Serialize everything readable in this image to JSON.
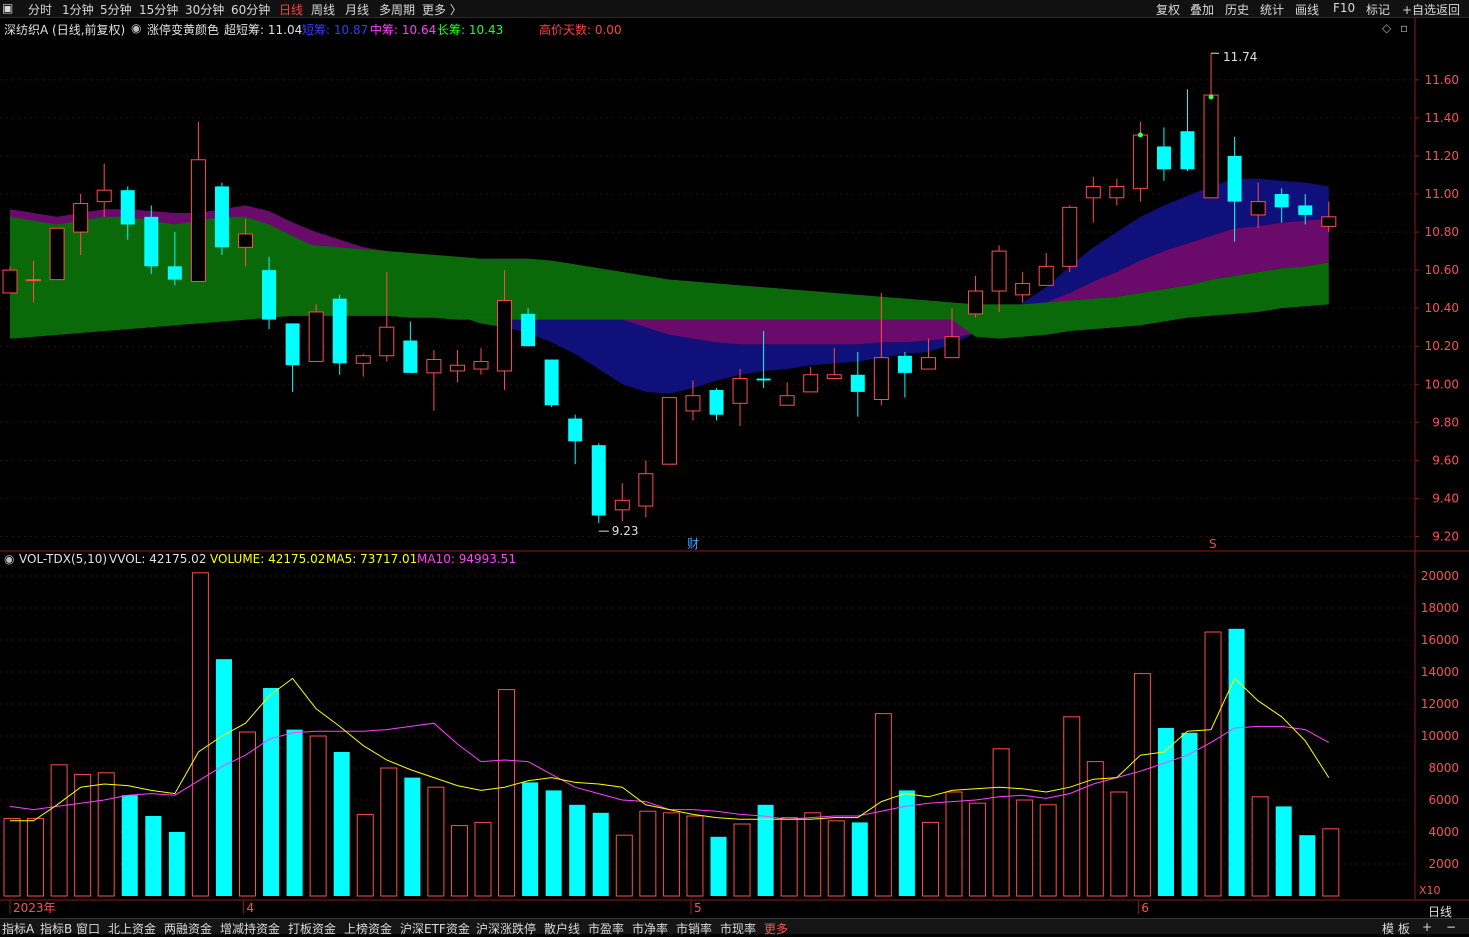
{
  "topbar": {
    "periods": [
      "分时",
      "1分钟",
      "5分钟",
      "15分钟",
      "30分钟",
      "60分钟",
      "日线",
      "周线",
      "月线",
      "多周期",
      "更多 〉"
    ],
    "active": "日线",
    "right": [
      "复权",
      "叠加",
      "历史",
      "统计",
      "画线",
      "F10",
      "标记",
      "+自选",
      "返回"
    ]
  },
  "main": {
    "stock": "深纺织A (日线,前复权)",
    "indicator": "涨停变黄颜色",
    "super_short": "超短筹: 11.04",
    "short": "短筹: 10.87",
    "mid": "中筹: 10.64",
    "long": "长筹: 10.43",
    "high_days": "高价天数: 0.00",
    "hi_label": "11.74",
    "lo_label": "9.23",
    "cai_marker": "财",
    "s_marker": "S"
  },
  "vol": {
    "title": "VOL-TDX(5,10)",
    "vvol": "VVOL: 42175.02",
    "volume": "VOLUME: 42175.02",
    "ma5": "MA5: 73717.01",
    "ma10": "MA10: 94993.51",
    "unit": "X10"
  },
  "period_label": "日线",
  "bottombar": {
    "tabs": [
      "指标A",
      "指标B",
      "窗口",
      "北上资金",
      "两融资金",
      "增减持资金",
      "打板资金",
      "上榜资金",
      "沪深ETF资金",
      "沪深涨跌停",
      "散户线",
      "市盈率",
      "市净率",
      "市销率",
      "市现率",
      "更多"
    ],
    "right": [
      "模 板",
      "+",
      "−"
    ]
  },
  "colors": {
    "up": "#ff4d4d",
    "down": "#00ffff",
    "ma5": "#ffff00",
    "ma10": "#ff40ff",
    "band_green": "#0a6a0a",
    "band_purple": "#6a0a6a",
    "band_blue": "#10107a"
  },
  "chart_data": {
    "type": "candlestick",
    "price_axis": {
      "ticks": [
        9.2,
        9.4,
        9.6,
        9.8,
        10.0,
        10.2,
        10.4,
        10.6,
        10.8,
        11.0,
        11.2,
        11.4,
        11.6
      ],
      "range": [
        9.15,
        11.82
      ]
    },
    "volume_axis": {
      "ticks": [
        2000,
        4000,
        6000,
        8000,
        10000,
        12000,
        14000,
        16000,
        18000,
        20000
      ],
      "range": [
        0,
        21000
      ],
      "unit": "X10"
    },
    "x_labels": [
      {
        "index": 0,
        "text": "2023年"
      },
      {
        "index": 10,
        "text": "4"
      },
      {
        "index": 29,
        "text": "5"
      },
      {
        "index": 48,
        "text": "6"
      }
    ],
    "candles": [
      [
        10.48,
        10.6,
        10.62,
        10.48
      ],
      [
        10.55,
        10.55,
        10.65,
        10.43
      ],
      [
        10.55,
        10.82,
        10.82,
        10.55
      ],
      [
        10.8,
        10.95,
        11.0,
        10.68
      ],
      [
        10.96,
        11.02,
        11.16,
        10.88
      ],
      [
        11.02,
        10.84,
        11.04,
        10.76
      ],
      [
        10.88,
        10.62,
        10.94,
        10.58
      ],
      [
        10.62,
        10.55,
        10.8,
        10.52
      ],
      [
        10.54,
        11.18,
        11.38,
        10.54
      ],
      [
        11.04,
        10.72,
        11.06,
        10.68
      ],
      [
        10.72,
        10.79,
        10.87,
        10.62
      ],
      [
        10.6,
        10.34,
        10.67,
        10.29
      ],
      [
        10.32,
        10.1,
        10.32,
        9.96
      ],
      [
        10.12,
        10.38,
        10.42,
        10.14
      ],
      [
        10.45,
        10.11,
        10.47,
        10.05
      ],
      [
        10.11,
        10.15,
        10.16,
        10.04
      ],
      [
        10.15,
        10.3,
        10.59,
        10.12
      ],
      [
        10.23,
        10.06,
        10.33,
        10.06
      ],
      [
        10.06,
        10.13,
        10.18,
        9.86
      ],
      [
        10.07,
        10.1,
        10.18,
        10.01
      ],
      [
        10.08,
        10.12,
        10.19,
        10.05
      ],
      [
        10.07,
        10.44,
        10.6,
        9.97
      ],
      [
        10.37,
        10.2,
        10.4,
        10.2
      ],
      [
        10.13,
        9.89,
        10.13,
        9.88
      ],
      [
        9.82,
        9.7,
        9.84,
        9.58
      ],
      [
        9.68,
        9.31,
        9.69,
        9.27
      ],
      [
        9.34,
        9.39,
        9.48,
        9.28
      ],
      [
        9.36,
        9.53,
        9.6,
        9.3
      ],
      [
        9.58,
        9.93,
        9.93,
        9.58
      ],
      [
        9.86,
        9.94,
        10.02,
        9.81
      ],
      [
        9.97,
        9.84,
        9.98,
        9.81
      ],
      [
        9.9,
        10.03,
        10.08,
        9.78
      ],
      [
        10.03,
        10.02,
        10.28,
        9.98
      ],
      [
        9.89,
        9.94,
        10.01,
        9.89
      ],
      [
        9.96,
        10.05,
        10.09,
        9.96
      ],
      [
        10.03,
        10.05,
        10.19,
        10.03
      ],
      [
        10.05,
        9.96,
        10.17,
        9.83
      ],
      [
        9.92,
        10.14,
        10.48,
        9.89
      ],
      [
        10.15,
        10.06,
        10.17,
        9.93
      ],
      [
        10.08,
        10.14,
        10.24,
        10.08
      ],
      [
        10.14,
        10.25,
        10.4,
        10.14
      ],
      [
        10.37,
        10.49,
        10.57,
        10.35
      ],
      [
        10.49,
        10.7,
        10.73,
        10.38
      ],
      [
        10.47,
        10.53,
        10.59,
        10.43
      ],
      [
        10.52,
        10.62,
        10.69,
        10.54
      ],
      [
        10.62,
        10.93,
        10.94,
        10.59
      ],
      [
        10.98,
        11.04,
        11.09,
        10.85
      ],
      [
        10.98,
        11.04,
        11.08,
        10.94
      ],
      [
        11.03,
        11.31,
        11.38,
        10.96
      ],
      [
        11.25,
        11.13,
        11.35,
        11.07
      ],
      [
        11.33,
        11.13,
        11.55,
        11.12
      ],
      [
        10.98,
        11.52,
        11.74,
        10.98
      ],
      [
        11.2,
        10.96,
        11.3,
        10.75
      ],
      [
        10.89,
        10.96,
        11.06,
        10.82
      ],
      [
        11.0,
        10.93,
        11.03,
        10.85
      ],
      [
        10.94,
        10.89,
        11.0,
        10.84
      ],
      [
        10.83,
        10.88,
        10.96,
        10.8
      ]
    ],
    "volumes": [
      4850,
      4850,
      8200,
      7600,
      7700,
      6300,
      5000,
      4000,
      20200,
      14800,
      10250,
      13000,
      10400,
      10000,
      9000,
      5100,
      8000,
      7400,
      6800,
      4400,
      4600,
      12900,
      7100,
      6600,
      5700,
      5200,
      3800,
      5300,
      5200,
      5000,
      3700,
      4500,
      5700,
      4900,
      5200,
      4700,
      4600,
      11400,
      6600,
      4600,
      6500,
      5800,
      9200,
      6000,
      5700,
      11200,
      8400,
      6500,
      13900,
      10500,
      10200,
      16500,
      16700,
      6200,
      5600,
      3800,
      4200
    ],
    "ma5": [
      4700,
      4700,
      5700,
      6800,
      7000,
      6900,
      6600,
      6400,
      9000,
      10000,
      10800,
      12500,
      13600,
      11700,
      10600,
      9400,
      8500,
      7900,
      7400,
      6900,
      6600,
      6800,
      7200,
      7400,
      7100,
      7000,
      6800,
      5700,
      5400,
      5100,
      4900,
      4800,
      4800,
      4800,
      4800,
      4900,
      4900,
      5900,
      6400,
      6200,
      6600,
      6700,
      6800,
      6700,
      6500,
      6800,
      7300,
      7400,
      8800,
      9000,
      10300,
      10400,
      13600,
      12200,
      11200,
      9700,
      7400
    ],
    "ma10": [
      5600,
      5400,
      5600,
      5800,
      6000,
      6300,
      6400,
      6300,
      7200,
      8100,
      8800,
      9800,
      10200,
      10300,
      10300,
      10300,
      10400,
      10600,
      10800,
      9500,
      8400,
      8500,
      8400,
      7600,
      6800,
      6400,
      6000,
      5900,
      5400,
      5400,
      5300,
      5100,
      5000,
      4800,
      4900,
      5000,
      5000,
      5300,
      5600,
      5800,
      5900,
      6000,
      6200,
      6300,
      6100,
      6400,
      7000,
      7400,
      7800,
      8300,
      8800,
      9600,
      10500,
      10600,
      10600,
      10400,
      9600
    ],
    "band_super_short": [
      10.88,
      10.86,
      10.84,
      10.86,
      10.88,
      10.88,
      10.86,
      10.84,
      10.86,
      10.88,
      10.88,
      10.84,
      10.78,
      10.72,
      10.66,
      10.6,
      10.54,
      10.48,
      10.42,
      10.36,
      10.32,
      10.3,
      10.27,
      10.22,
      10.16,
      10.08,
      10.0,
      9.96,
      9.95,
      9.98,
      10.02,
      10.05,
      10.07,
      10.08,
      10.1,
      10.11,
      10.12,
      10.14,
      10.16,
      10.17,
      10.21,
      10.27,
      10.35,
      10.43,
      10.51,
      10.62,
      10.72,
      10.8,
      10.88,
      10.94,
      10.99,
      11.04,
      11.08,
      11.08,
      11.07,
      11.06,
      11.04
    ],
    "band_short": [
      10.92,
      10.9,
      10.88,
      10.9,
      10.92,
      10.92,
      10.91,
      10.9,
      10.9,
      10.92,
      10.94,
      10.91,
      10.85,
      10.8,
      10.76,
      10.72,
      10.68,
      10.65,
      10.62,
      10.58,
      10.55,
      10.53,
      10.51,
      10.48,
      10.44,
      10.4,
      10.34,
      10.3,
      10.26,
      10.24,
      10.22,
      10.21,
      10.21,
      10.21,
      10.21,
      10.21,
      10.21,
      10.22,
      10.22,
      10.23,
      10.24,
      10.27,
      10.31,
      10.36,
      10.42,
      10.48,
      10.54,
      10.59,
      10.65,
      10.7,
      10.74,
      10.78,
      10.82,
      10.83,
      10.85,
      10.86,
      10.87
    ],
    "band_mid": [
      10.7,
      10.7,
      10.7,
      10.71,
      10.72,
      10.73,
      10.73,
      10.74,
      10.75,
      10.75,
      10.75,
      10.75,
      10.74,
      10.73,
      10.72,
      10.71,
      10.7,
      10.69,
      10.68,
      10.67,
      10.66,
      10.66,
      10.66,
      10.65,
      10.63,
      10.61,
      10.59,
      10.57,
      10.55,
      10.54,
      10.53,
      10.52,
      10.51,
      10.5,
      10.49,
      10.48,
      10.47,
      10.46,
      10.45,
      10.44,
      10.43,
      10.42,
      10.42,
      10.42,
      10.43,
      10.44,
      10.45,
      10.46,
      10.48,
      10.5,
      10.52,
      10.55,
      10.57,
      10.59,
      10.61,
      10.62,
      10.64
    ],
    "band_long": [
      10.24,
      10.25,
      10.26,
      10.27,
      10.28,
      10.29,
      10.3,
      10.31,
      10.32,
      10.33,
      10.34,
      10.35,
      10.36,
      10.36,
      10.36,
      10.36,
      10.36,
      10.35,
      10.35,
      10.34,
      10.34,
      10.34,
      10.34,
      10.34,
      10.34,
      10.34,
      10.34,
      10.34,
      10.34,
      10.34,
      10.34,
      10.34,
      10.34,
      10.34,
      10.34,
      10.34,
      10.34,
      10.34,
      10.34,
      10.34,
      10.34,
      10.25,
      10.24,
      10.25,
      10.26,
      10.28,
      10.29,
      10.3,
      10.31,
      10.33,
      10.35,
      10.36,
      10.37,
      10.38,
      10.4,
      10.41,
      10.42
    ],
    "band_start_index": 0,
    "green_band_end": 21,
    "marker_hi_index": 51,
    "marker_lo_index": 25,
    "cai_index": 29,
    "s_index": 51
  }
}
